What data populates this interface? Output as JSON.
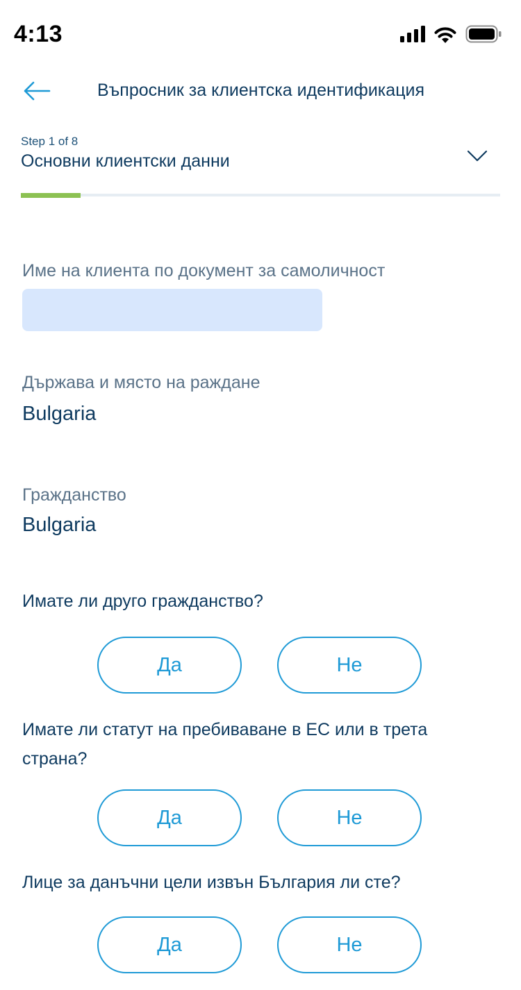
{
  "status_bar": {
    "time": "4:13",
    "icons": [
      "signal-icon",
      "wifi-icon",
      "battery-icon"
    ]
  },
  "header": {
    "back_icon": "arrow-left-icon",
    "title": "Въпросник за клиентска идентификация"
  },
  "step": {
    "counter": "Step 1 of 8",
    "title": "Основни клиентски данни",
    "expand_icon": "chevron-down-icon",
    "progress_fraction": 0.125
  },
  "fields": {
    "client_name": {
      "label": "Име на клиента по документ за самоличност",
      "value": ""
    },
    "birth_place": {
      "label": "Държава и място на раждане",
      "value": "Bulgaria"
    },
    "citizenship": {
      "label": "Гражданство",
      "value": "Bulgaria"
    }
  },
  "questions": [
    {
      "text": "Имате ли друго гражданство?",
      "yes_label": "Да",
      "no_label": "Не"
    },
    {
      "text": "Имате ли статут на пребиваване в ЕС или в трета страна?",
      "yes_label": "Да",
      "no_label": "Не"
    },
    {
      "text": "Лице за данъчни цели извън България ли сте?",
      "yes_label": "Да",
      "no_label": "Не"
    }
  ],
  "colors": {
    "text_primary": "#0e3a5f",
    "label": "#5a7288",
    "accent": "#1e9ad6",
    "progress": "#8cc152",
    "input_bg": "#d8e7fd"
  }
}
